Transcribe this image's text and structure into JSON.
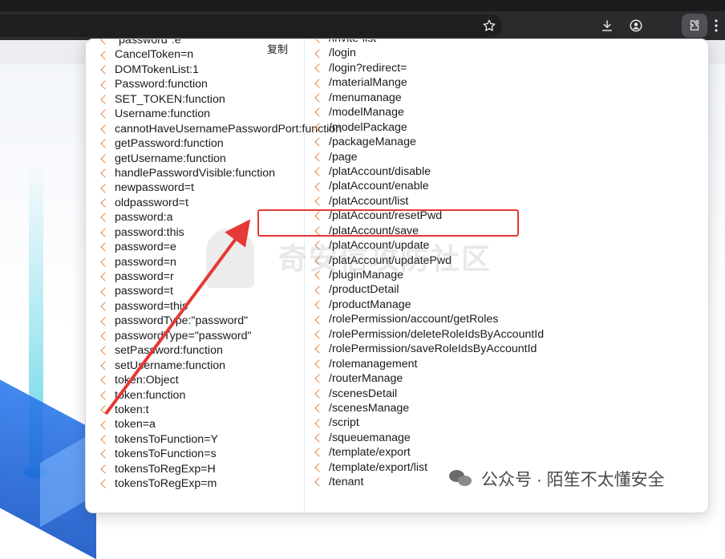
{
  "popup": {
    "copy_label": "复制",
    "left_items": [
      "\"password\":e",
      "CancelToken=n",
      "DOMTokenList:1",
      "Password:function",
      "SET_TOKEN:function",
      "Username:function",
      "cannotHaveUsernamePasswordPort:function",
      "getPassword:function",
      "getUsername:function",
      "handlePasswordVisible:function",
      "newpassword=t",
      "oldpassword=t",
      "password:a",
      "password:this",
      "password=e",
      "password=n",
      "password=r",
      "password=t",
      "password=this",
      "passwordType:\"password\"",
      "passwordType=\"password\"",
      "setPassword:function",
      "setUsername:function",
      "token:Object",
      "token:function",
      "token:t",
      "token=a",
      "tokensToFunction=Y",
      "tokensToFunction=s",
      "tokensToRegExp=H",
      "tokensToRegExp=m"
    ],
    "right_items": [
      "/invite-list",
      "/login",
      "/login?redirect=",
      "/materialMange",
      "/menumanage",
      "/modelManage",
      "/modelPackage",
      "/packageManage",
      "/page",
      "/platAccount/disable",
      "/platAccount/enable",
      "/platAccount/list",
      "/platAccount/resetPwd",
      "/platAccount/save",
      "/platAccount/update",
      "/platAccount/updatePwd",
      "/pluginManage",
      "/productDetail",
      "/productManage",
      "/rolePermission/account/getRoles",
      "/rolePermission/deleteRoleIdsByAccountId",
      "/rolePermission/saveRoleIdsByAccountId",
      "/rolemanagement",
      "/routerManage",
      "/scenesDetail",
      "/scenesManage",
      "/script",
      "/squeuemanage",
      "/template/export",
      "/template/export/list",
      "/tenant"
    ]
  },
  "watermark": {
    "text": "奇安信攻防社区"
  },
  "footer": {
    "account": "公众号 · 陌笙不太懂安全"
  },
  "colors": {
    "accent_chevron": "#e8823a",
    "highlight": "#e53935"
  }
}
